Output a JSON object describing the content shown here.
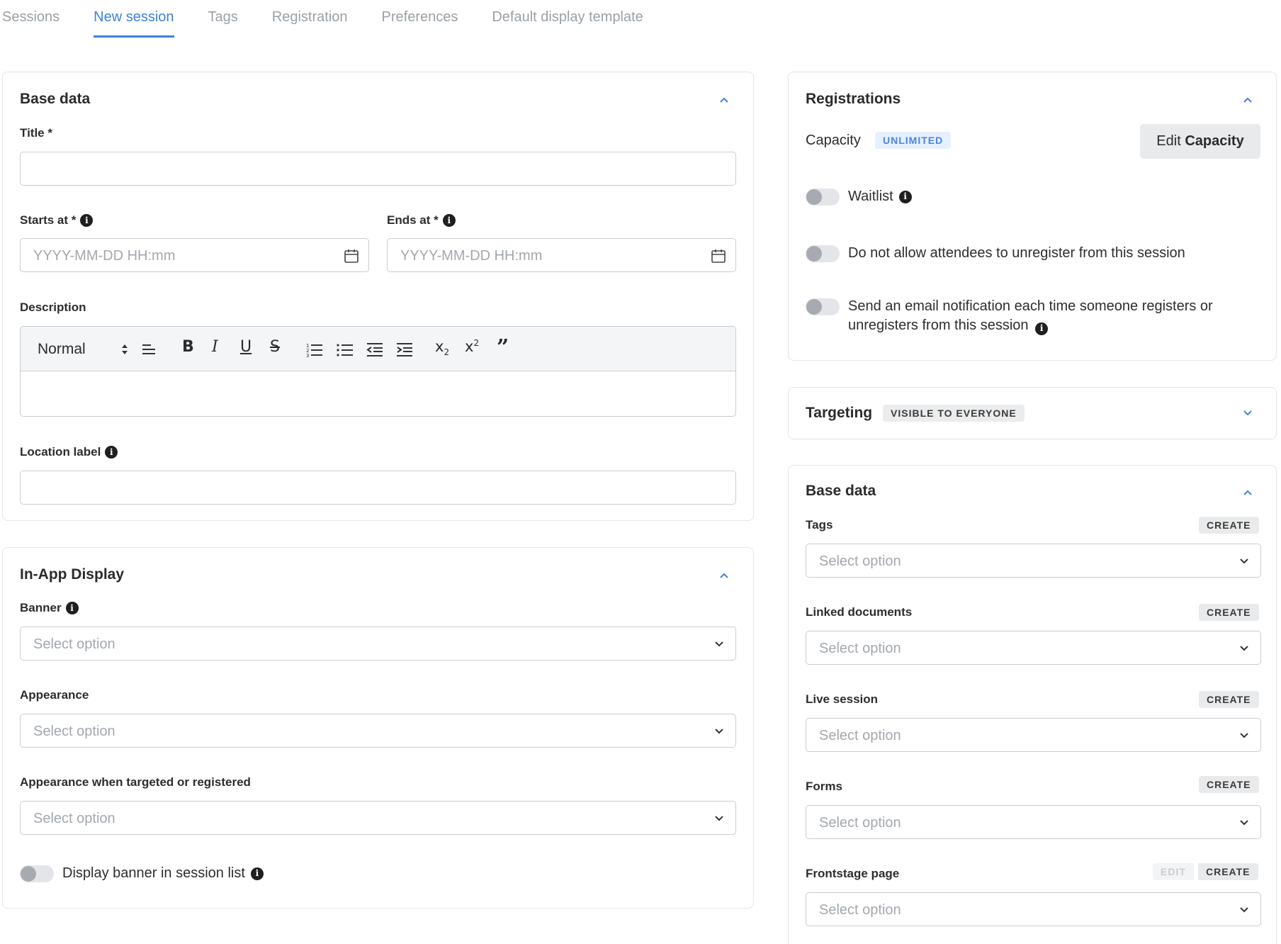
{
  "tabs": [
    "Sessions",
    "New session",
    "Tags",
    "Registration",
    "Preferences",
    "Default display template"
  ],
  "base_data_left": {
    "title": "Base data",
    "title_label": "Title *",
    "starts_label": "Starts at *",
    "ends_label": "Ends at *",
    "date_placeholder": "YYYY-MM-DD HH:mm",
    "description_label": "Description",
    "toolbar": {
      "format": "Normal",
      "icons": [
        "align-icon",
        "bold-icon",
        "italic-icon",
        "underline-icon",
        "strike-icon",
        "ordered-list-icon",
        "bullet-list-icon",
        "outdent-icon",
        "indent-icon",
        "subscript-icon",
        "superscript-icon",
        "quote-icon"
      ]
    },
    "location_label": "Location label"
  },
  "in_app_display": {
    "title": "In-App Display",
    "banner_label": "Banner",
    "appearance_label": "Appearance",
    "appearance_targeted_label": "Appearance when targeted or registered",
    "select_placeholder": "Select option",
    "display_banner_label": "Display banner in session list"
  },
  "registrations": {
    "title": "Registrations",
    "capacity_label": "Capacity",
    "capacity_badge": "UNLIMITED",
    "edit_capacity_prefix": "Edit ",
    "edit_capacity_bold": "Capacity",
    "waitlist_label": "Waitlist",
    "no_unregister_label": "Do not allow attendees to unregister from this session",
    "email_notification_label": "Send an email notification each time someone registers or unregisters from this session"
  },
  "targeting": {
    "title": "Targeting",
    "badge": "VISIBLE TO EVERYONE"
  },
  "base_data_right": {
    "title": "Base data",
    "create_label": "CREATE",
    "edit_label": "EDIT",
    "select_placeholder": "Select option",
    "fields": [
      "Tags",
      "Linked documents",
      "Live session",
      "Forms",
      "Frontstage page"
    ]
  },
  "colors": {
    "accent": "#3b82e0",
    "badge_blue_bg": "#e6efff",
    "border": "#c9ccd1"
  }
}
